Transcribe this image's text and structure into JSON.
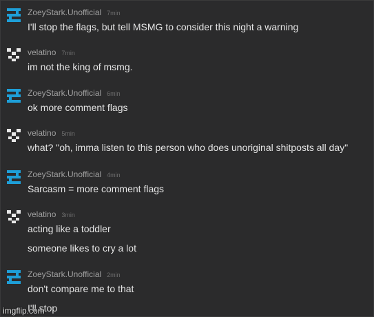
{
  "comments": [
    {
      "user": "ZoeyStark.Unofficial",
      "time": "7min",
      "avatar": "cyan-glyph-icon",
      "lines": [
        "I'll stop the flags, but tell MSMG to consider this night a warning"
      ]
    },
    {
      "user": "velatino",
      "time": "7min",
      "avatar": "pixel-face-icon",
      "lines": [
        "im not the king of msmg."
      ]
    },
    {
      "user": "ZoeyStark.Unofficial",
      "time": "6min",
      "avatar": "cyan-glyph-icon",
      "lines": [
        "ok more comment flags"
      ]
    },
    {
      "user": "velatino",
      "time": "5min",
      "avatar": "pixel-face-icon",
      "lines": [
        "what? \"oh, imma listen to this person who does unoriginal shitposts all day\""
      ]
    },
    {
      "user": "ZoeyStark.Unofficial",
      "time": "4min",
      "avatar": "cyan-glyph-icon",
      "lines": [
        "Sarcasm = more comment flags"
      ]
    },
    {
      "user": "velatino",
      "time": "3min",
      "avatar": "pixel-face-icon",
      "lines": [
        "acting like a toddler",
        "someone likes to cry a lot"
      ]
    },
    {
      "user": "ZoeyStark.Unofficial",
      "time": "2min",
      "avatar": "cyan-glyph-icon",
      "lines": [
        "don't compare me to that",
        "I'll stop"
      ]
    }
  ],
  "watermark": "imgflip.com",
  "colors": {
    "background": "#2b2b2c",
    "accent_avatar": "#1e9fd8",
    "text": "#e4e4e4",
    "username": "#a0a0a0",
    "time": "#6f6f6f"
  }
}
